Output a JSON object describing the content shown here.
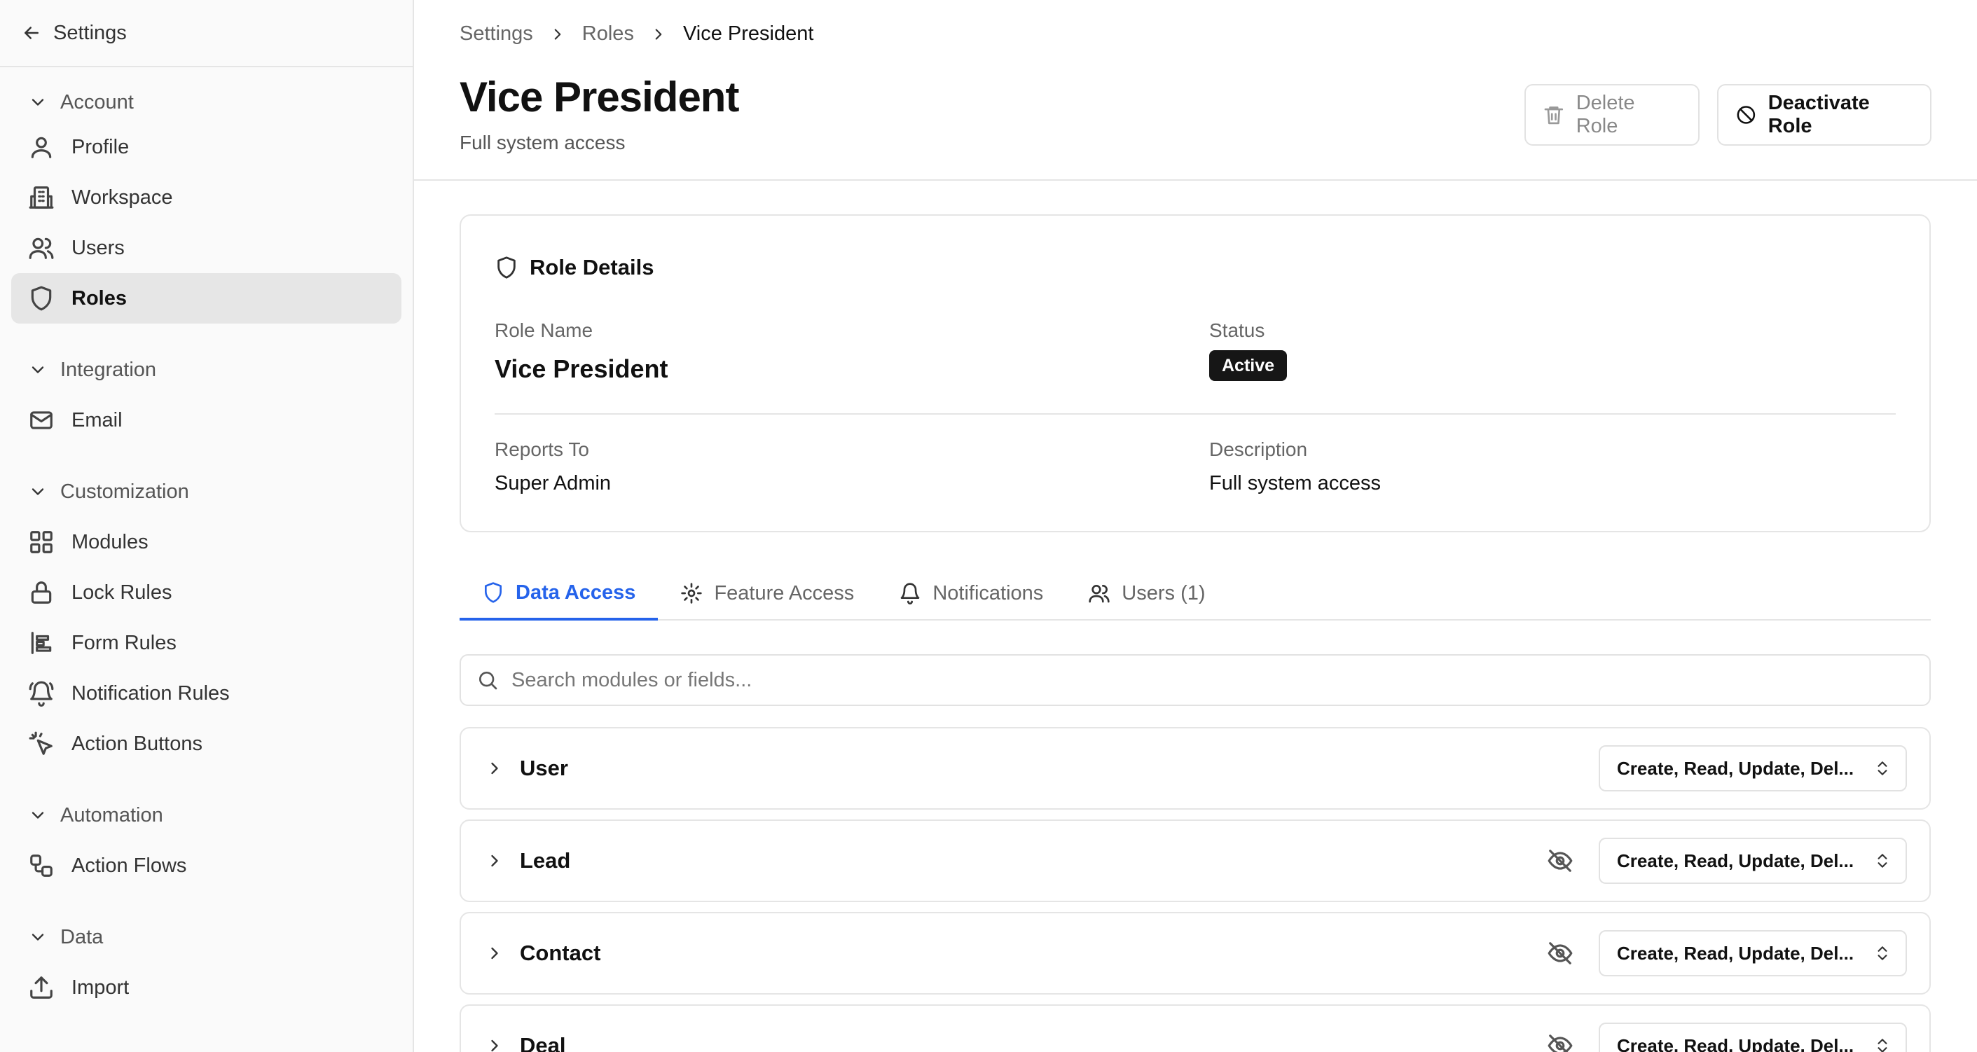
{
  "sidebar": {
    "back_label": "Settings",
    "groups": [
      {
        "label": "Account",
        "items": [
          {
            "label": "Profile",
            "icon": "user-icon"
          },
          {
            "label": "Workspace",
            "icon": "building-icon"
          },
          {
            "label": "Users",
            "icon": "users-icon"
          },
          {
            "label": "Roles",
            "icon": "shield-icon",
            "active": true
          }
        ]
      },
      {
        "label": "Integration",
        "items": [
          {
            "label": "Email",
            "icon": "mail-icon"
          }
        ]
      },
      {
        "label": "Customization",
        "items": [
          {
            "label": "Modules",
            "icon": "grid-icon"
          },
          {
            "label": "Lock Rules",
            "icon": "lock-icon"
          },
          {
            "label": "Form Rules",
            "icon": "align-left-icon"
          },
          {
            "label": "Notification Rules",
            "icon": "bell-ring-icon"
          },
          {
            "label": "Action Buttons",
            "icon": "pointer-click-icon"
          }
        ]
      },
      {
        "label": "Automation",
        "items": [
          {
            "label": "Action Flows",
            "icon": "workflow-icon"
          }
        ]
      },
      {
        "label": "Data",
        "items": [
          {
            "label": "Import",
            "icon": "upload-icon"
          }
        ]
      }
    ]
  },
  "breadcrumb": [
    "Settings",
    "Roles",
    "Vice President"
  ],
  "header": {
    "title": "Vice President",
    "subtitle": "Full system access",
    "delete_label": "Delete Role",
    "deactivate_label": "Deactivate Role"
  },
  "details": {
    "title": "Role Details",
    "role_name_label": "Role Name",
    "role_name": "Vice President",
    "status_label": "Status",
    "status": "Active",
    "reports_to_label": "Reports To",
    "reports_to": "Super Admin",
    "description_label": "Description",
    "description": "Full system access"
  },
  "tabs": [
    {
      "label": "Data Access",
      "icon": "shield-icon",
      "active": true
    },
    {
      "label": "Feature Access",
      "icon": "gear-icon"
    },
    {
      "label": "Notifications",
      "icon": "bell-icon"
    },
    {
      "label": "Users (1)",
      "icon": "users-icon"
    }
  ],
  "search": {
    "placeholder": "Search modules or fields..."
  },
  "modules": [
    {
      "label": "User",
      "permissions": "Create, Read, Update, Del...",
      "hidden_icon": false
    },
    {
      "label": "Lead",
      "permissions": "Create, Read, Update, Del...",
      "hidden_icon": true
    },
    {
      "label": "Contact",
      "permissions": "Create, Read, Update, Del...",
      "hidden_icon": true
    },
    {
      "label": "Deal",
      "permissions": "Create, Read, Update, Del...",
      "hidden_icon": true
    }
  ],
  "colors": {
    "accent": "#2563eb",
    "badge_bg": "#161616",
    "active_nav_bg": "#e6e6e6"
  }
}
